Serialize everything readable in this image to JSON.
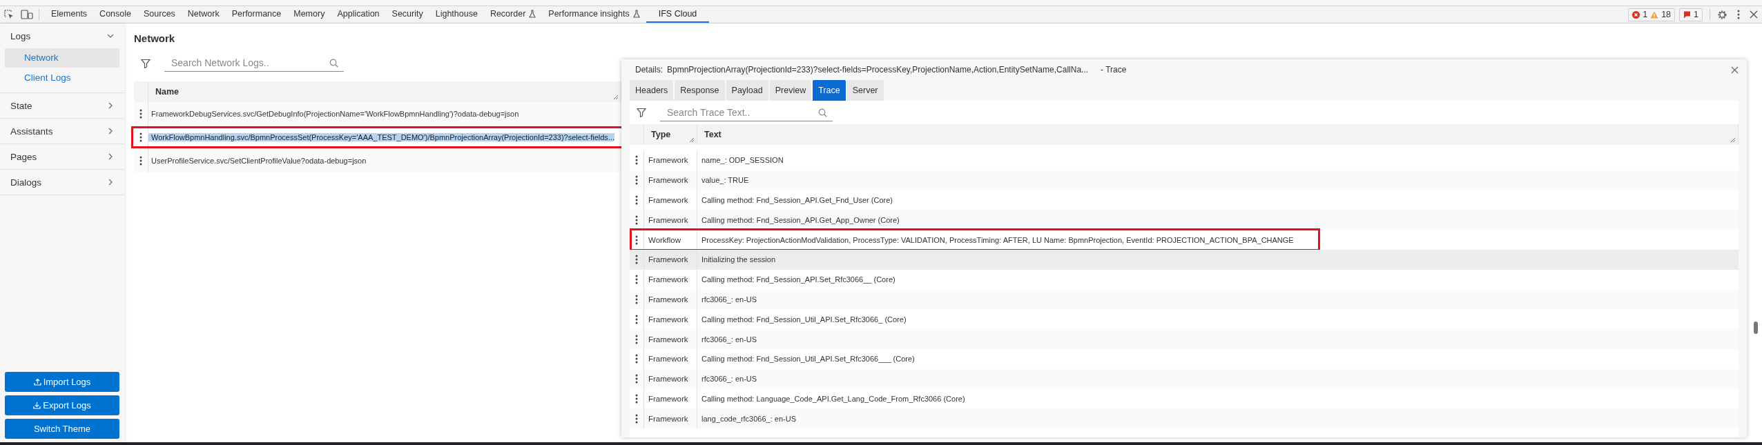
{
  "devtools": {
    "tabs": [
      {
        "label": "Elements",
        "selected": false,
        "experimental": false
      },
      {
        "label": "Console",
        "selected": false,
        "experimental": false
      },
      {
        "label": "Sources",
        "selected": false,
        "experimental": false
      },
      {
        "label": "Network",
        "selected": false,
        "experimental": false
      },
      {
        "label": "Performance",
        "selected": false,
        "experimental": false
      },
      {
        "label": "Memory",
        "selected": false,
        "experimental": false
      },
      {
        "label": "Application",
        "selected": false,
        "experimental": false
      },
      {
        "label": "Security",
        "selected": false,
        "experimental": false
      },
      {
        "label": "Lighthouse",
        "selected": false,
        "experimental": false
      },
      {
        "label": "Recorder",
        "selected": false,
        "experimental": true
      },
      {
        "label": "Performance insights",
        "selected": false,
        "experimental": true
      },
      {
        "label": "IFS Cloud",
        "selected": true,
        "experimental": false
      }
    ],
    "counts": {
      "errors": "1",
      "warnings": "18",
      "issues": "1"
    }
  },
  "sidebar": {
    "groups": [
      {
        "label": "Logs",
        "expanded": true,
        "children": [
          {
            "label": "Network",
            "selected": true
          },
          {
            "label": "Client Logs",
            "selected": false
          }
        ]
      },
      {
        "label": "State",
        "expanded": false
      },
      {
        "label": "Assistants",
        "expanded": false
      },
      {
        "label": "Pages",
        "expanded": false
      },
      {
        "label": "Dialogs",
        "expanded": false
      }
    ],
    "buttons": [
      {
        "label": "Import Logs",
        "kind": "import"
      },
      {
        "label": "Export Logs",
        "kind": "export"
      },
      {
        "label": "Switch Theme",
        "kind": "plain"
      }
    ]
  },
  "network": {
    "title": "Network",
    "search": {
      "placeholder": "Search Network Logs.."
    },
    "columns": [
      "Name"
    ],
    "rows": [
      {
        "name": "FrameworkDebugServices.svc/GetDebugInfo(ProjectionName='WorkFlowBpmnHandling')?odata-debug=json",
        "selected": false,
        "marked": false
      },
      {
        "name": "WorkFlowBpmnHandling.svc/BpmnProcessSet(ProcessKey='AAA_TEST_DEMO')/BpmnProjectionArray(ProjectionId=233)?select-fields...",
        "selected": true,
        "marked": true
      },
      {
        "name": "UserProfileService.svc/SetClientProfileValue?odata-debug=json",
        "selected": false,
        "marked": false
      }
    ]
  },
  "details": {
    "label": "Details:",
    "name": "BpmnProjectionArray(ProjectionId=233)?select-fields=ProcessKey,ProjectionName,Action,EntitySetName,CallNa...",
    "suffix": "- Trace",
    "tabs": [
      {
        "label": "Headers",
        "selected": false
      },
      {
        "label": "Response",
        "selected": false
      },
      {
        "label": "Payload",
        "selected": false
      },
      {
        "label": "Preview",
        "selected": false
      },
      {
        "label": "Trace",
        "selected": true
      },
      {
        "label": "Server",
        "selected": false
      }
    ],
    "search": {
      "placeholder": "Search Trace Text.."
    },
    "columns": [
      "Type",
      "Text"
    ],
    "rows": [
      {
        "type": "Framework",
        "text": "name_: ODP_SESSION",
        "marked": false,
        "hovered": false
      },
      {
        "type": "Framework",
        "text": "value_: TRUE",
        "marked": false,
        "hovered": false
      },
      {
        "type": "Framework",
        "text": "Calling method: Fnd_Session_API.Get_Fnd_User (Core)",
        "marked": false,
        "hovered": false
      },
      {
        "type": "Framework",
        "text": "Calling method: Fnd_Session_API.Get_App_Owner (Core)",
        "marked": false,
        "hovered": false
      },
      {
        "type": "Workflow",
        "text": "ProcessKey: ProjectionActionModValidation, ProcessType: VALIDATION, ProcessTiming: AFTER, LU Name: BpmnProjection, EventId: PROJECTION_ACTION_BPA_CHANGE",
        "marked": true,
        "hovered": false
      },
      {
        "type": "Framework",
        "text": "Initializing the session",
        "marked": false,
        "hovered": true
      },
      {
        "type": "Framework",
        "text": "Calling method: Fnd_Session_API.Set_Rfc3066__ (Core)",
        "marked": false,
        "hovered": false
      },
      {
        "type": "Framework",
        "text": "rfc3066_: en-US",
        "marked": false,
        "hovered": false
      },
      {
        "type": "Framework",
        "text": "Calling method: Fnd_Session_Util_API.Set_Rfc3066_ (Core)",
        "marked": false,
        "hovered": false
      },
      {
        "type": "Framework",
        "text": "rfc3066_: en-US",
        "marked": false,
        "hovered": false
      },
      {
        "type": "Framework",
        "text": "Calling method: Fnd_Session_Util_API.Set_Rfc3066___ (Core)",
        "marked": false,
        "hovered": false
      },
      {
        "type": "Framework",
        "text": "rfc3066_: en-US",
        "marked": false,
        "hovered": false
      },
      {
        "type": "Framework",
        "text": "Calling method: Language_Code_API.Get_Lang_Code_From_Rfc3066 (Core)",
        "marked": false,
        "hovered": false
      },
      {
        "type": "Framework",
        "text": "lang_code_rfc3066_: en-US",
        "marked": false,
        "hovered": false
      }
    ]
  }
}
